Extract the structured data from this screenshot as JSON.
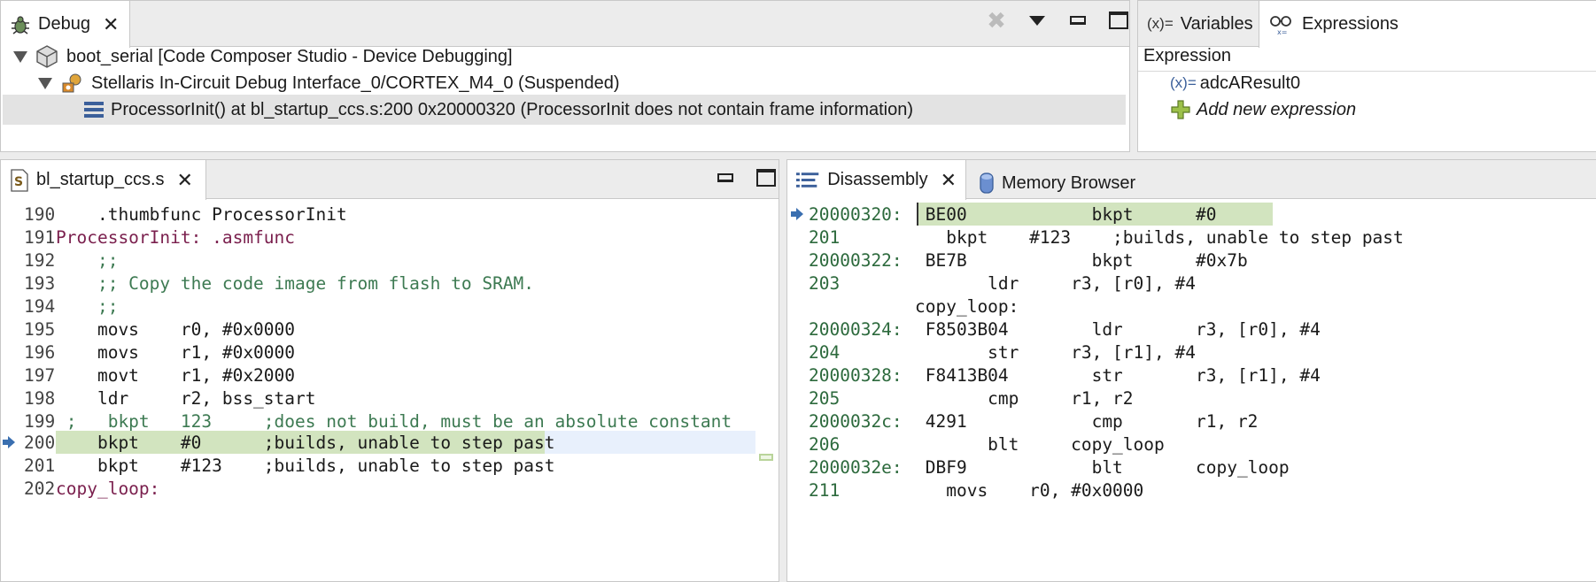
{
  "debug": {
    "tab_label": "Debug",
    "tree": [
      {
        "label": "boot_serial [Code Composer Studio - Device Debugging]"
      },
      {
        "label": "Stellaris In-Circuit Debug Interface_0/CORTEX_M4_0 (Suspended)"
      },
      {
        "label": "ProcessorInit() at bl_startup_ccs.s:200 0x20000320  (ProcessorInit does not contain frame information)"
      }
    ]
  },
  "vars": {
    "tab_variables": "Variables",
    "tab_expressions": "Expressions",
    "variables_icon": "(x)=",
    "column_header": "Expression",
    "expressions": [
      {
        "icon": "(x)=",
        "name": "adcAResult0"
      },
      {
        "icon": "+",
        "name": "Add new expression"
      }
    ]
  },
  "editor": {
    "tab_label": "bl_startup_ccs.s",
    "lines": [
      {
        "n": "190",
        "text": "    .thumbfunc ProcessorInit"
      },
      {
        "n": "191",
        "text": "ProcessorInit: .asmfunc"
      },
      {
        "n": "192",
        "text": "    ;;"
      },
      {
        "n": "193",
        "text": "    ;; Copy the code image from flash to SRAM."
      },
      {
        "n": "194",
        "text": "    ;;"
      },
      {
        "n": "195",
        "text": "    movs    r0, #0x0000"
      },
      {
        "n": "196",
        "text": "    movs    r1, #0x0000"
      },
      {
        "n": "197",
        "text": "    movt    r1, #0x2000"
      },
      {
        "n": "198",
        "text": "    ldr     r2, bss_start"
      },
      {
        "n": "199",
        "text": " ;   bkpt   123     ;does not build, must be an absolute constant"
      },
      {
        "n": "200",
        "text": "    bkpt    #0      ;builds, unable to step past"
      },
      {
        "n": "201",
        "text": "    bkpt    #123    ;builds, unable to step past"
      },
      {
        "n": "202",
        "text": "copy_loop:"
      }
    ]
  },
  "disasm": {
    "tab_label": "Disassembly",
    "tab_memory": "Memory Browser",
    "lines": [
      {
        "left": "20000320:",
        "text": " BE00            bkpt      #0"
      },
      {
        "left": "201",
        "text": "   bkpt    #123    ;builds, unable to step past"
      },
      {
        "left": "20000322:",
        "text": " BE7B            bkpt      #0x7b"
      },
      {
        "left": "203",
        "text": "       ldr     r3, [r0], #4"
      },
      {
        "left": "",
        "text": "copy_loop:"
      },
      {
        "left": "20000324:",
        "text": " F8503B04        ldr       r3, [r0], #4"
      },
      {
        "left": "204",
        "text": "       str     r3, [r1], #4"
      },
      {
        "left": "20000328:",
        "text": " F8413B04        str       r3, [r1], #4"
      },
      {
        "left": "205",
        "text": "       cmp     r1, r2"
      },
      {
        "left": "2000032c:",
        "text": " 4291            cmp       r1, r2"
      },
      {
        "left": "206",
        "text": "       blt     copy_loop"
      },
      {
        "left": "2000032e:",
        "text": " DBF9            blt       copy_loop"
      },
      {
        "left": "211",
        "text": "   movs    r0, #0x0000"
      }
    ]
  },
  "colors": {
    "current_line": "#d2e4bf",
    "selection": "#e3e3e3",
    "addr_green": "#2d6a3d"
  }
}
